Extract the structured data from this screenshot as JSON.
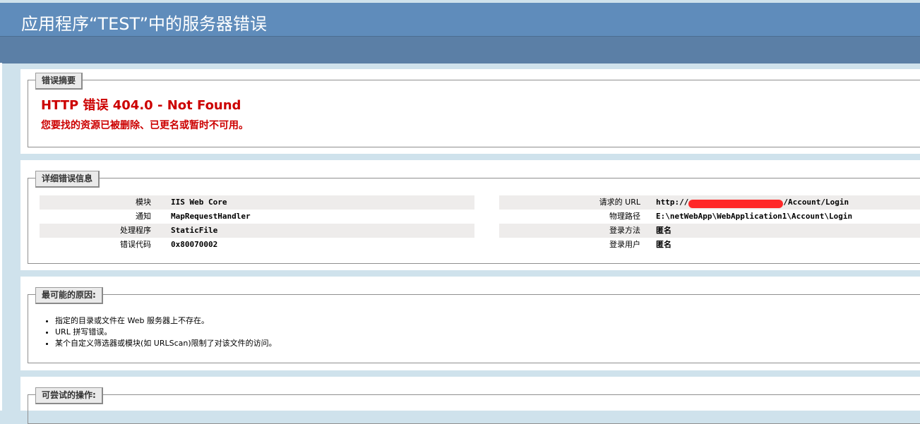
{
  "page": {
    "title": "应用程序“TEST”中的服务器错误"
  },
  "summary": {
    "legend": "错误摘要",
    "heading": "HTTP 错误 404.0 - Not Found",
    "message": "您要找的资源已被删除、已更名或暂时不可用。"
  },
  "details": {
    "legend": "详细错误信息",
    "left": [
      {
        "label": "模块",
        "value": "IIS Web Core"
      },
      {
        "label": "通知",
        "value": "MapRequestHandler"
      },
      {
        "label": "处理程序",
        "value": "StaticFile"
      },
      {
        "label": "错误代码",
        "value": "0x80070002"
      }
    ],
    "right": [
      {
        "label": "请求的 URL",
        "value_prefix": "http://",
        "value_suffix": "/Account/Login"
      },
      {
        "label": "物理路径",
        "value": "E:\\netWebApp\\WebApplication1\\Account\\Login"
      },
      {
        "label": "登录方法",
        "value": "匿名"
      },
      {
        "label": "登录用户",
        "value": "匿名"
      }
    ]
  },
  "causes": {
    "legend": "最可能的原因:",
    "items": [
      "指定的目录或文件在 Web 服务器上不存在。",
      "URL 拼写错误。",
      "某个自定义筛选器或模块(如 URLScan)限制了对该文件的访问。"
    ]
  },
  "actions": {
    "legend": "可尝试的操作:"
  },
  "colors": {
    "header": "#5f8cbb",
    "subbar": "#5b7fa6",
    "background": "#cfe2ec",
    "error": "#cc0000",
    "redaction": "#ff2828"
  }
}
